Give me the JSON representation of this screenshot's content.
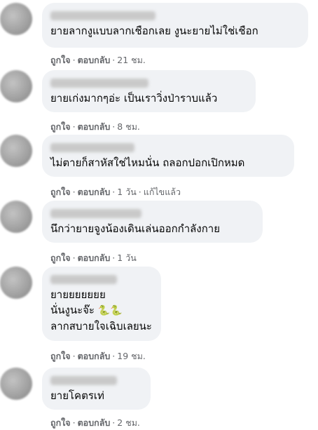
{
  "comments": [
    {
      "text_lines": [
        "ยายลากงูแบบลากเชือกเลย งูนะยายไม่ใช่เชือก"
      ],
      "like": "ถูกใจ",
      "reply": "ตอบกลับ",
      "time": "21 ชม."
    },
    {
      "text_lines": [
        "ยายเก่งมากๆอ่ะ เป็นเราวิ่งป่าราบแล้ว"
      ],
      "like": "ถูกใจ",
      "reply": "ตอบกลับ",
      "time": "8 ชม."
    },
    {
      "text_lines": [
        "ไม่ตายก็สาหัสใช่ไหมนั่น ถลอกปอกเปิกหมด"
      ],
      "like": "ถูกใจ",
      "reply": "ตอบกลับ",
      "time": "1 วัน",
      "edited": "แก้ไขแล้ว"
    },
    {
      "text_lines": [
        "นึกว่ายายจูงน้องเดินเล่นออกกำลังกาย"
      ],
      "like": "ถูกใจ",
      "reply": "ตอบกลับ",
      "time": "1 วัน"
    },
    {
      "text_lines": [
        "ยายยยยยยย",
        "นั่นงูนะจ๊ะ",
        "ลากสบายใจเฉิบเลยนะ"
      ],
      "emoji": "🐍🐍",
      "like": "ถูกใจ",
      "reply": "ตอบกลับ",
      "time": "19 ชม."
    },
    {
      "text_lines": [
        "ยายโคตรเท่"
      ],
      "like": "ถูกใจ",
      "reply": "ตอบกลับ",
      "time": "2 ชม."
    }
  ]
}
